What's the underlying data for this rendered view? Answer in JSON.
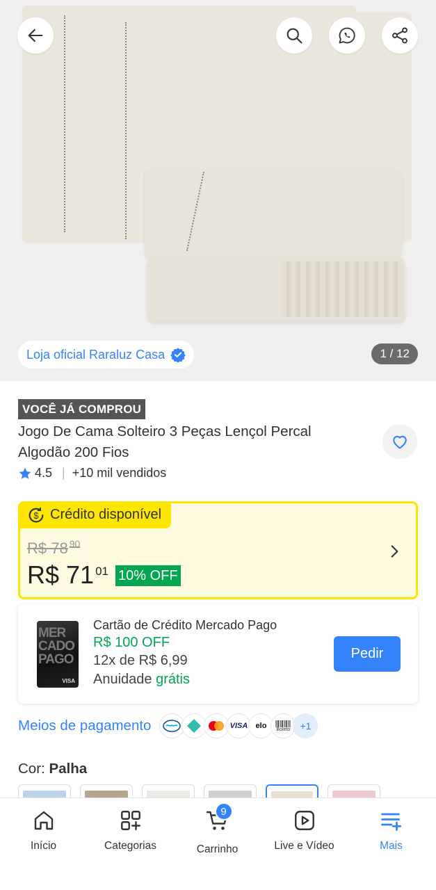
{
  "gallery": {
    "store_label": "Loja oficial Raraluz Casa",
    "counter": "1 / 12"
  },
  "product": {
    "badge": "VOCÊ JÁ COMPROU",
    "title": "Jogo De Cama Solteiro 3 Peças Lençol Percal Algodão 200 Fios",
    "rating": "4.5",
    "sold": "+10 mil vendidos"
  },
  "price": {
    "credit_label": "Crédito disponível",
    "old_price": "R$ 78",
    "old_cents": "90",
    "new_price": "R$ 71",
    "new_cents": "01",
    "discount": "10% OFF"
  },
  "card_offer": {
    "title": "Cartão de Crédito Mercado Pago",
    "off": "R$ 100 OFF",
    "installments": "12x de R$ 6,99",
    "annual_prefix": "Anuidade",
    "annual_value": "grátis",
    "button": "Pedir",
    "card_text": "MER CADO PAGO",
    "card_brand": "VISA"
  },
  "payments": {
    "label": "Meios de pagamento",
    "methods": [
      "mercado-pago",
      "pix",
      "mastercard",
      "VISA",
      "elo",
      "Boleto"
    ],
    "more": "+1"
  },
  "color": {
    "label": "Cor:",
    "value": "Palha",
    "swatches": [
      "#bcd3ee",
      "#b9a58e",
      "#eceae6",
      "#d0d0d0",
      "#e9e0cf",
      "#eec9d0"
    ]
  },
  "nav": {
    "home": "Início",
    "categories": "Categorias",
    "cart": "Carrinho",
    "cart_count": "9",
    "live": "Live e Vídeo",
    "more": "Mais"
  },
  "colors": {
    "accent": "#3483fa",
    "yellow": "#ffe600",
    "green": "#00a650"
  }
}
